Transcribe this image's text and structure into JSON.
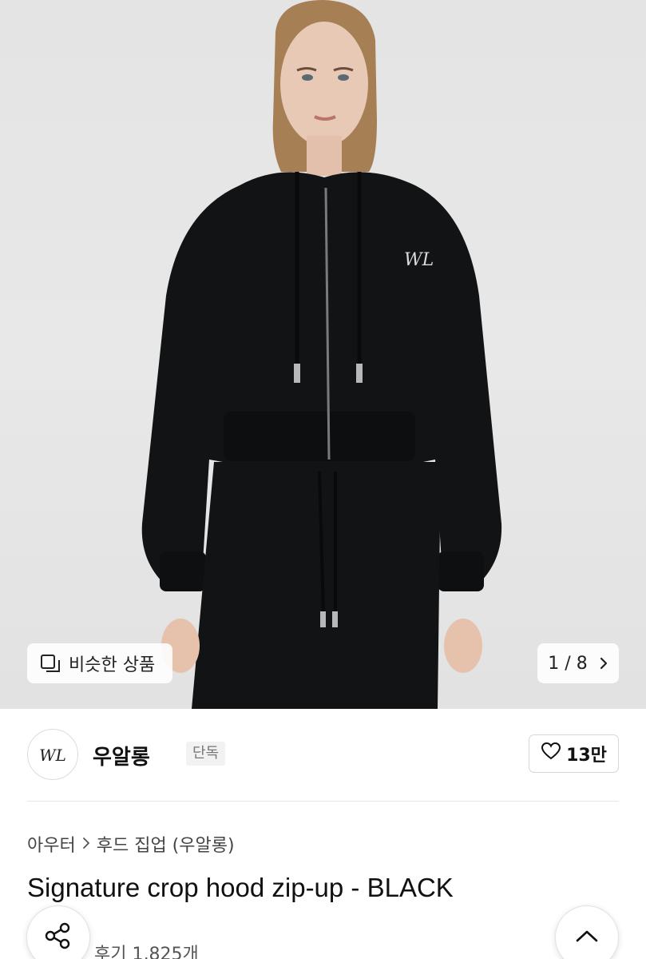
{
  "hero": {
    "similar_label": "비슷한 상품",
    "page_indicator": "1 / 8",
    "current_page": 1,
    "total_pages": 8
  },
  "brand": {
    "logo_text": "WL",
    "name": "우알롱",
    "badge": "단독",
    "likes": "13만"
  },
  "product": {
    "breadcrumb": [
      "아우터",
      "후드 집업 (우알롱)"
    ],
    "title": "Signature crop hood zip-up - BLACK",
    "reviews": "후기 1,825개"
  },
  "colors": {
    "garment": "#111315",
    "background": "#e6e6e6",
    "text_primary": "#111111",
    "text_secondary": "#555555"
  },
  "icons": {
    "similar": "similar-items-icon",
    "page_next": "chevron-right-icon",
    "like": "heart-icon",
    "breadcrumb_sep": "chevron-right-icon",
    "share": "share-icon",
    "scroll_top": "chevron-up-icon"
  }
}
